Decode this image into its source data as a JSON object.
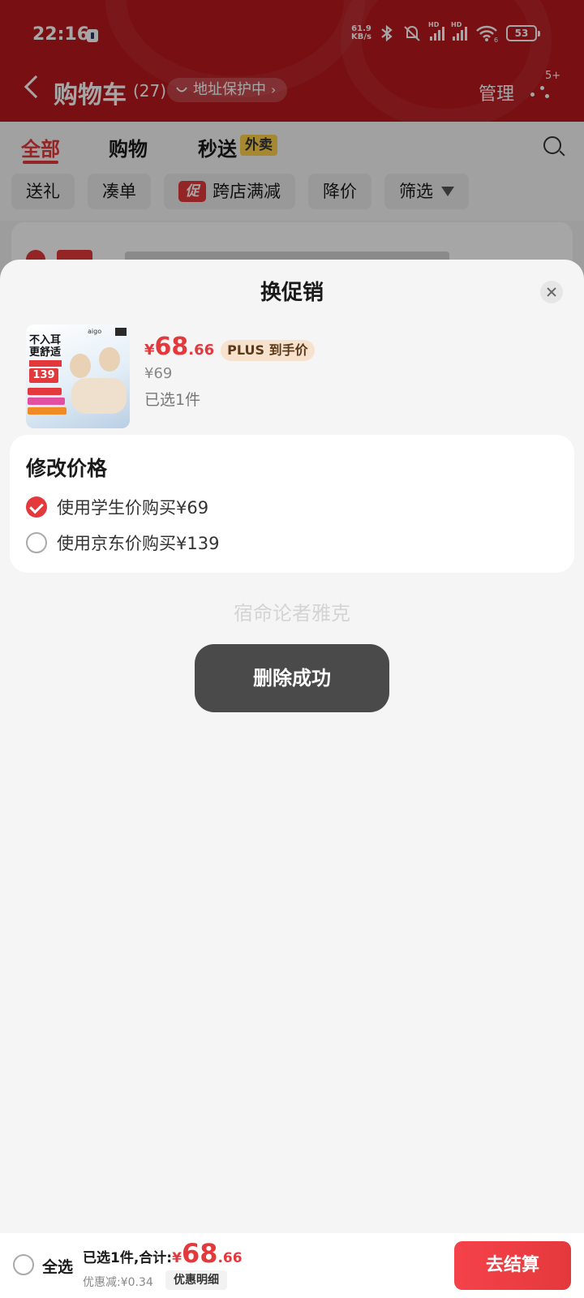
{
  "status_bar": {
    "time": "22:16",
    "net_speed_value": "61.9",
    "net_speed_unit": "KB/s",
    "hd_label_1": "HD",
    "hd_label_2": "HD",
    "wifi_level": "6",
    "battery": "53"
  },
  "nav": {
    "back_icon": "chevron-left-icon",
    "title": "购物车",
    "count": "(27)",
    "address_protect": "地址保护中",
    "manage": "管理",
    "more_badge": "5+"
  },
  "tabs": [
    {
      "label": "全部",
      "active": true
    },
    {
      "label": "购物",
      "active": false
    },
    {
      "label": "秒送",
      "active": false
    }
  ],
  "tabs_extra": {
    "waimai_tag": "外卖",
    "search_icon": "search-icon"
  },
  "filters": [
    {
      "label": "送礼"
    },
    {
      "label": "凑单"
    },
    {
      "label": "跨店满减",
      "tag": "促"
    },
    {
      "label": "降价"
    },
    {
      "label": "筛选",
      "icon": "filter-icon"
    }
  ],
  "sheet": {
    "title": "换促销",
    "close_icon": "close-icon",
    "product": {
      "image_text_1": "不入耳",
      "image_text_2": "更舒适",
      "image_brand": "aigo",
      "image_price": "139",
      "price_symbol": "¥",
      "price_int": "68",
      "price_dec": ".66",
      "plus_tag": "PLUS 到手价",
      "original_price": "¥69",
      "selected_count": "已选1件"
    },
    "modify_price": {
      "title": "修改价格",
      "options": [
        {
          "label": "使用学生价购买¥69",
          "checked": true
        },
        {
          "label": "使用京东价购买¥139",
          "checked": false
        }
      ]
    },
    "watermark": "宿命论者雅克",
    "toast": "删除成功"
  },
  "bottom_bar": {
    "select_all": "全选",
    "summary_label": "已选1件,合计:",
    "total_symbol": "¥",
    "total_int": "68",
    "total_dec": ".66",
    "discount": "优惠减:¥0.34",
    "detail_button": "优惠明细",
    "checkout": "去结算"
  },
  "colors": {
    "brand_red": "#e4393c",
    "header_red": "#b8191e",
    "toast_bg": "#4a4a4a"
  }
}
